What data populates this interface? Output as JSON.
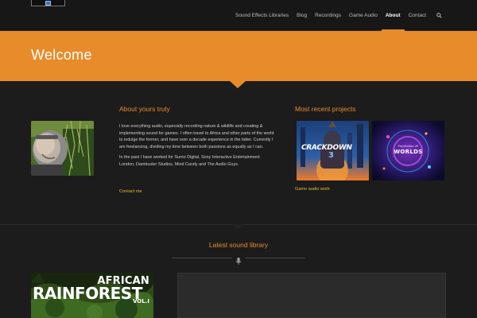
{
  "header": {
    "nav": [
      {
        "label": "Sound Effects Libraries"
      },
      {
        "label": "Blog"
      },
      {
        "label": "Recordings"
      },
      {
        "label": "Game Audio"
      },
      {
        "label": "About",
        "active": true
      },
      {
        "label": "Contact"
      }
    ],
    "search_icon": "search-icon"
  },
  "banner": {
    "title": "Welcome"
  },
  "about": {
    "heading": "About yours truly",
    "paragraph1": "I love everything audio, especially recording nature & wildlife and creating & implementing sound for games. I often travel to Africa and other parts of the world to indulge the former, and have over a decade experience in the latter. Currently I am freelancing, dividing my time between both passions as equally as I can.",
    "paragraph2": "In the past I have worked for Sumo Digital, Sony Interactive Entertainment London, Dambuster Studios, Mind Candy and The Audio Guys.",
    "contact_link": "Contact me"
  },
  "projects": {
    "heading": "Most recent projects",
    "items": [
      {
        "title": "CRACKDOWN",
        "number": "3"
      },
      {
        "title": "WORLDS",
        "prefix": "PlayStation VR"
      }
    ],
    "link": "Game audio work"
  },
  "latest": {
    "heading": "Latest sound library",
    "cover": {
      "line1": "AFRICAN",
      "line2": "RAINFOREST",
      "vol": "VOL.I"
    }
  },
  "colors": {
    "accent": "#e88b2b",
    "link": "#e8b73b",
    "background": "#1c1c1c",
    "header": "#171717"
  }
}
